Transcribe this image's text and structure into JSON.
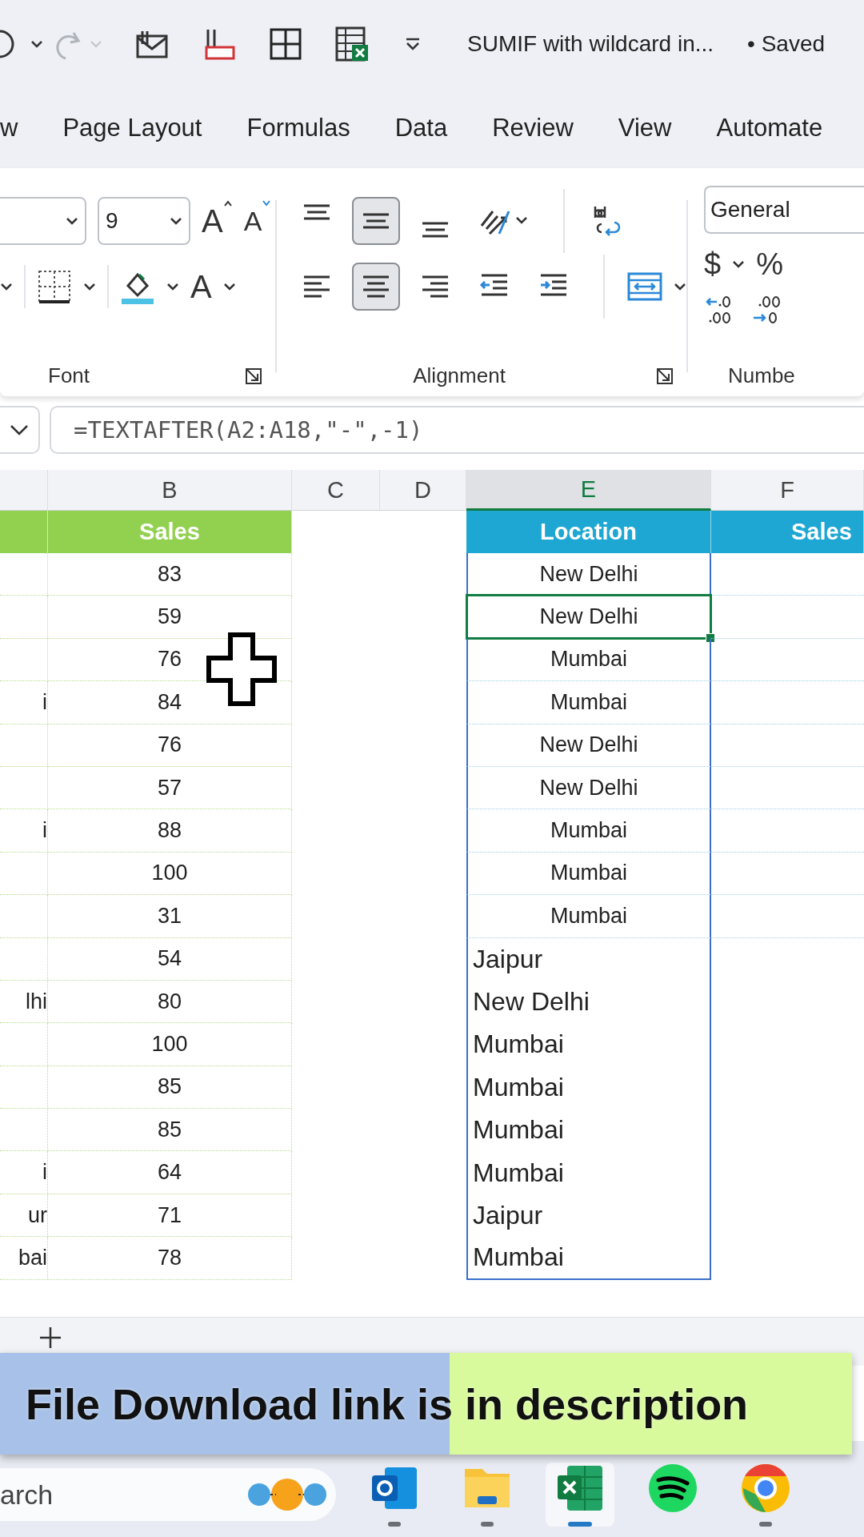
{
  "title_bar": {
    "title": "SUMIF with wildcard in...",
    "status": "• Saved",
    "redo_disabled": true
  },
  "tabs": [
    {
      "label": "w",
      "selected": false
    },
    {
      "label": "Page Layout",
      "selected": false
    },
    {
      "label": "Formulas",
      "selected": false
    },
    {
      "label": "Data",
      "selected": false
    },
    {
      "label": "Review",
      "selected": false
    },
    {
      "label": "View",
      "selected": false
    },
    {
      "label": "Automate",
      "selected": false
    }
  ],
  "ribbon": {
    "font": {
      "size": "9",
      "grow_glyph": "A",
      "shrink_glyph": "A",
      "color_glyph": "A",
      "label": "Font"
    },
    "alignment": {
      "label": "Alignment",
      "top_row": [
        {
          "kind": "top",
          "selected": false
        },
        {
          "kind": "middle",
          "selected": true
        },
        {
          "kind": "bottom",
          "selected": false
        },
        {
          "kind": "orientation",
          "selected": false
        }
      ],
      "bottom_row": [
        {
          "kind": "left",
          "selected": false
        },
        {
          "kind": "center",
          "selected": true
        },
        {
          "kind": "right",
          "selected": false
        },
        {
          "kind": "outdent",
          "selected": false
        },
        {
          "kind": "indent",
          "selected": false
        }
      ]
    },
    "number": {
      "format": "General",
      "currency": "$",
      "percent": "%",
      "label": "Numbe"
    }
  },
  "formula_bar": {
    "formula": "=TEXTAFTER(A2:A18,\"-\",-1)"
  },
  "columns": [
    {
      "label": "B",
      "selected": false
    },
    {
      "label": "C",
      "selected": false
    },
    {
      "label": "D",
      "selected": false
    },
    {
      "label": "E",
      "selected": true
    },
    {
      "label": "F",
      "selected": false
    }
  ],
  "headers": {
    "b": "Sales",
    "e": "Location",
    "f": "Sales"
  },
  "rows": [
    {
      "a": "",
      "b": "83",
      "e": "New Delhi",
      "kind": "table",
      "selected": false
    },
    {
      "a": "",
      "b": "59",
      "e": "New Delhi",
      "kind": "table",
      "selected": true
    },
    {
      "a": "",
      "b": "76",
      "e": "Mumbai",
      "kind": "table",
      "selected": false
    },
    {
      "a": "i",
      "b": "84",
      "e": "Mumbai",
      "kind": "table",
      "selected": false
    },
    {
      "a": "",
      "b": "76",
      "e": "New Delhi",
      "kind": "table",
      "selected": false
    },
    {
      "a": "",
      "b": "57",
      "e": "New Delhi",
      "kind": "table",
      "selected": false
    },
    {
      "a": "i",
      "b": "88",
      "e": "Mumbai",
      "kind": "table",
      "selected": false
    },
    {
      "a": "",
      "b": "100",
      "e": "Mumbai",
      "kind": "table",
      "selected": false
    },
    {
      "a": "",
      "b": "31",
      "e": "Mumbai",
      "kind": "table",
      "selected": false
    },
    {
      "a": "",
      "b": "54",
      "e": "Jaipur",
      "kind": "spill",
      "selected": false
    },
    {
      "a": "lhi",
      "b": "80",
      "e": "New Delhi",
      "kind": "spill",
      "selected": false
    },
    {
      "a": "",
      "b": "100",
      "e": "Mumbai",
      "kind": "spill",
      "selected": false
    },
    {
      "a": "",
      "b": "85",
      "e": "Mumbai",
      "kind": "spill",
      "selected": false
    },
    {
      "a": "",
      "b": "85",
      "e": "Mumbai",
      "kind": "spill",
      "selected": false
    },
    {
      "a": "i",
      "b": "64",
      "e": "Mumbai",
      "kind": "spill",
      "selected": false
    },
    {
      "a": "ur",
      "b": "71",
      "e": "Jaipur",
      "kind": "spill",
      "selected": false
    },
    {
      "a": "bai",
      "b": "78",
      "e": "Mumbai",
      "kind": "spill",
      "selected": false
    }
  ],
  "banner": {
    "text": "File Download link is in description"
  },
  "taskbar": {
    "search": "arch",
    "apps": [
      {
        "kind": "mail",
        "selected": false,
        "running": true
      },
      {
        "kind": "folder",
        "selected": false,
        "running": true
      },
      {
        "kind": "sheet",
        "selected": true,
        "running": true
      },
      {
        "kind": "music",
        "selected": false,
        "running": false
      },
      {
        "kind": "browser",
        "selected": false,
        "running": true
      }
    ]
  }
}
